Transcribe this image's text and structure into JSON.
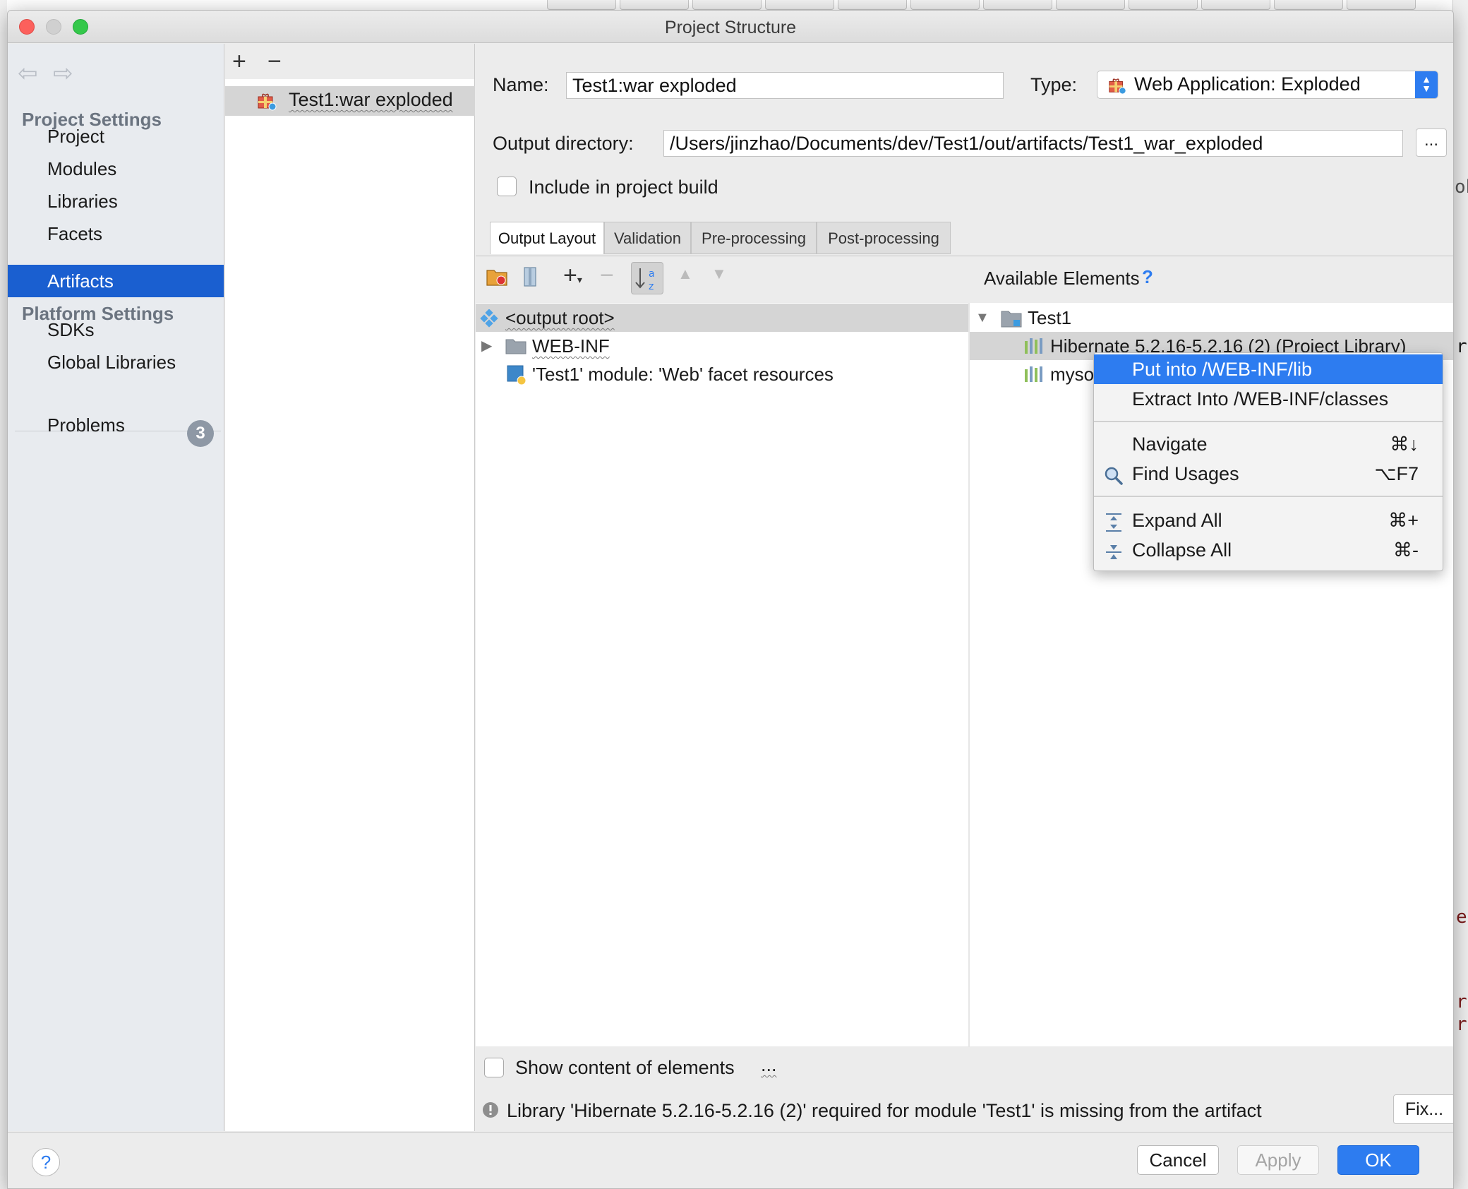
{
  "window": {
    "title": "Project Structure"
  },
  "nav": {
    "project_settings_header": "Project Settings",
    "platform_settings_header": "Platform Settings",
    "items": [
      {
        "label": "Project"
      },
      {
        "label": "Modules"
      },
      {
        "label": "Libraries"
      },
      {
        "label": "Facets"
      },
      {
        "label": "Artifacts",
        "selected": true
      }
    ],
    "platform_items": [
      {
        "label": "SDKs"
      },
      {
        "label": "Global Libraries"
      }
    ],
    "problems": {
      "label": "Problems",
      "count": "3"
    }
  },
  "artifacts": {
    "add": "+",
    "remove": "−",
    "items": [
      {
        "label": "Test1:war exploded"
      }
    ]
  },
  "form": {
    "name_label": "Name:",
    "name_value": "Test1:war exploded",
    "type_label": "Type:",
    "type_value": "Web Application: Exploded",
    "output_label": "Output directory:",
    "output_value": "/Users/jinzhao/Documents/dev/Test1/out/artifacts/Test1_war_exploded",
    "browse": "...",
    "include_label": "Include in project build"
  },
  "tabs": [
    {
      "label": "Output Layout",
      "active": true
    },
    {
      "label": "Validation"
    },
    {
      "label": "Pre-processing"
    },
    {
      "label": "Post-processing"
    }
  ],
  "layout_tree": [
    {
      "label": "<output root>"
    },
    {
      "label": "WEB-INF"
    },
    {
      "label": "'Test1' module: 'Web' facet resources"
    }
  ],
  "available": {
    "title": "Available Elements",
    "help": "?",
    "root": "Test1",
    "items": [
      {
        "label": "Hibernate 5.2.16-5.2.16 (2) (Project Library)"
      },
      {
        "label": "myso"
      }
    ]
  },
  "context_menu": {
    "items": [
      {
        "label": "Put into /WEB-INF/lib",
        "shortcut": ""
      },
      {
        "label": "Extract Into /WEB-INF/classes",
        "shortcut": ""
      },
      {
        "label": "Navigate",
        "shortcut": "⌘↓"
      },
      {
        "label": "Find Usages",
        "shortcut": "⌥F7"
      },
      {
        "label": "Expand All",
        "shortcut": "⌘+"
      },
      {
        "label": "Collapse All",
        "shortcut": "⌘-"
      }
    ]
  },
  "footer": {
    "show_content_label": "Show content of elements",
    "show_content_more": "...",
    "warning": "Library 'Hibernate 5.2.16-5.2.16 (2)' required for module 'Test1' is missing from the artifact",
    "fix": "Fix..."
  },
  "buttons": {
    "help": "?",
    "cancel": "Cancel",
    "apply": "Apply",
    "ok": "OK"
  },
  "colors": {
    "accent": "#2d7cf0",
    "selection": "#1a5fd0",
    "badge": "#8e98a5"
  }
}
